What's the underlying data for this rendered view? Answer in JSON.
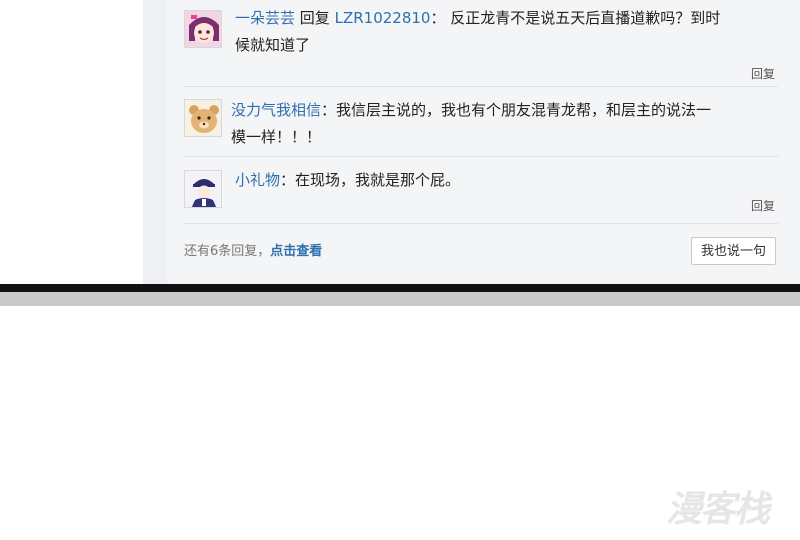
{
  "comments": [
    {
      "user": "一朵芸芸",
      "reply_word": "回复",
      "reply_to": "LZR1022810",
      "colon": "：",
      "text_line1": "反正龙青不是说五天后直播道歉吗？到时",
      "text_line2": "候就知道了",
      "reply_label": "回复"
    },
    {
      "user": "没力气我相信",
      "colon": "：",
      "text_line1": "我信层主说的，我也有个朋友混青龙帮，和层主的说法一",
      "text_line2": "模一样！！！"
    },
    {
      "user": "小礼物",
      "colon": "：",
      "text_line1": "在现场，我就是那个屁。",
      "reply_label": "回复"
    }
  ],
  "more": {
    "prefix": "还有6条回复，",
    "link": "点击查看"
  },
  "say_button": "我也说一句",
  "watermark": "漫客栈",
  "colors": {
    "username": "#2f6fae",
    "panel_bg": "#f4f5f7",
    "bezel": "#111111"
  }
}
